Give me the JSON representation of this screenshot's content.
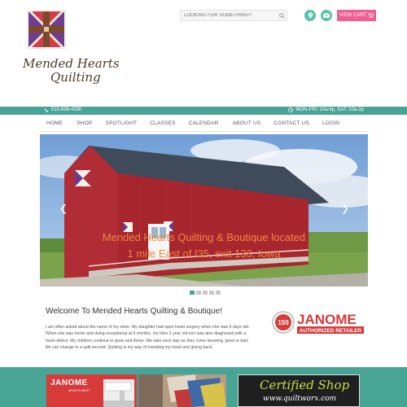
{
  "header": {
    "logo_line1": "Mended Hearts",
    "logo_line2": "Quilting",
    "search_placeholder": "LOOKING FOR SOMETHING?",
    "cart_label": "VIEW CART"
  },
  "infobar": {
    "phone": "515-836-4280",
    "hours": "MON-FRI: 10a-6p, SAT: 10a-2p"
  },
  "nav": {
    "items": [
      "HOME",
      "SHOP",
      "SPOTLIGHT",
      "CLASSES",
      "CALENDAR",
      "ABOUT US",
      "CONTACT US",
      "LOGIN"
    ]
  },
  "slider": {
    "caption_line1": "Mended Hearts Quilting & Boutique located",
    "caption_line2": "1 mile East of I35, exit 133, Iowa",
    "slide_count": 5,
    "active_slide": 1
  },
  "welcome": {
    "title": "Welcome To Mended Hearts Quilting & Boutique!",
    "body": "I am often asked about the name of my store. My daughter had open heart surgery when she was 6 days old. When she was home and doing exceptional at 6 months, my then 2 year old son was also diagnosed with a heart defect. My children continue to grow and thrive. We take each day as they come knowing, good or bad, life can change in a split second. Quilting is my way of mending my heart and giving back."
  },
  "janome": {
    "brand": "JANOME",
    "tag": "AUTHORIZED RETAILER",
    "badge": "150"
  },
  "promos": {
    "janome_brand": "JANOME",
    "janome_sub": "WHAT'S NEXT",
    "certified_line1": "Certified Shop",
    "certified_line2": "www.quiltworx.com"
  },
  "colors": {
    "teal": "#48a596",
    "pink": "#ef5f93",
    "caption_orange": "#f2863e",
    "janome_red": "#d83a3a"
  }
}
